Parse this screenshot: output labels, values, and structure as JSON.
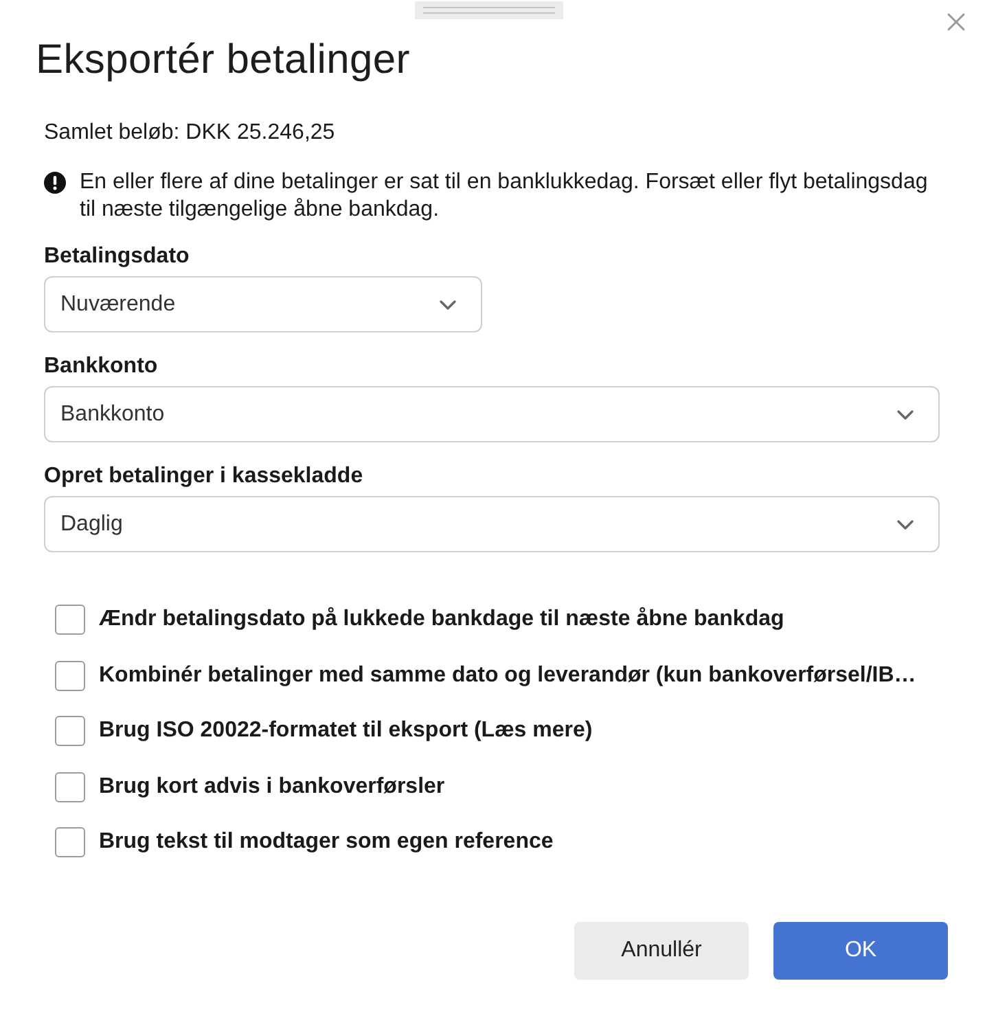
{
  "dialog": {
    "title": "Eksportér betalinger"
  },
  "total": "Samlet beløb: DKK 25.246,25",
  "warning": {
    "text": "En eller flere af dine betalinger er sat til en banklukkedag. Forsæt eller flyt betalingsdag til næste tilgængelige åbne bankdag."
  },
  "fields": [
    {
      "label": "Betalingsdato",
      "value": "Nuværende",
      "kind": "short"
    },
    {
      "label": "Bankkonto",
      "value": "Bankkonto",
      "kind": "wide"
    },
    {
      "label": "Opret betalinger i kassekladde",
      "value": "Daglig",
      "kind": "wide"
    }
  ],
  "options": [
    {
      "label": "Ændr betalingsdato på lukkede bankdage til næste åbne bankdag",
      "checked": false
    },
    {
      "label": "Kombinér betalinger med samme dato og leverandør (kun bankoverførsel/IB…",
      "checked": false
    },
    {
      "label": "Brug ISO 20022-formatet til eksport (Læs mere)",
      "checked": false
    },
    {
      "label": "Brug kort advis i bankoverførsler",
      "checked": false
    },
    {
      "label": "Brug tekst til modtager som egen reference",
      "checked": false
    }
  ],
  "buttons": [
    {
      "label": "Annullér",
      "kind": "secondary"
    },
    {
      "label": "OK",
      "kind": "primary"
    }
  ]
}
